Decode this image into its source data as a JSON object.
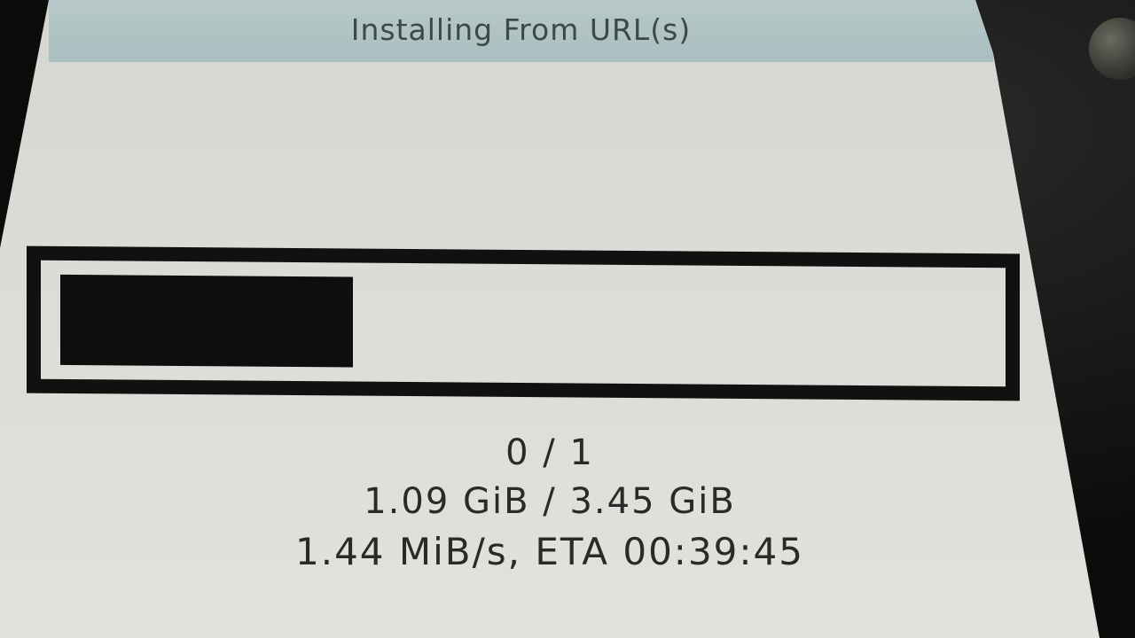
{
  "window": {
    "title": "Installing From URL(s)"
  },
  "progress": {
    "fraction": 0.316
  },
  "status": {
    "item_count": "0 / 1",
    "size_progress": "1.09 GiB / 3.45 GiB",
    "speed_eta": "1.44 MiB/s, ETA 00:39:45"
  }
}
